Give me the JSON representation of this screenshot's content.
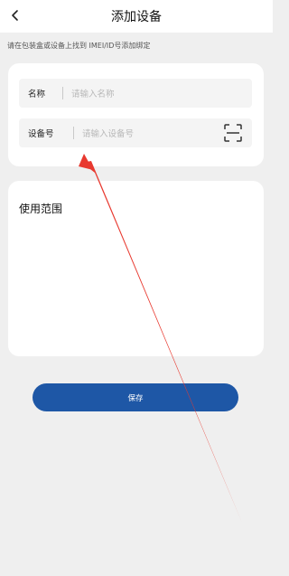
{
  "header": {
    "title": "添加设备"
  },
  "hint": "请在包装盒或设备上找到 IMEI/ID号添加绑定",
  "form": {
    "name_label": "名称",
    "name_placeholder": "请输入名称",
    "device_label": "设备号",
    "device_placeholder": "请输入设备号"
  },
  "range": {
    "title": "使用范围"
  },
  "save_label": "保存",
  "icons": {
    "back": "back-arrow-icon",
    "scan": "scan-icon"
  },
  "colors": {
    "primary": "#1e57a6",
    "annotation_arrow": "#e8392f"
  }
}
